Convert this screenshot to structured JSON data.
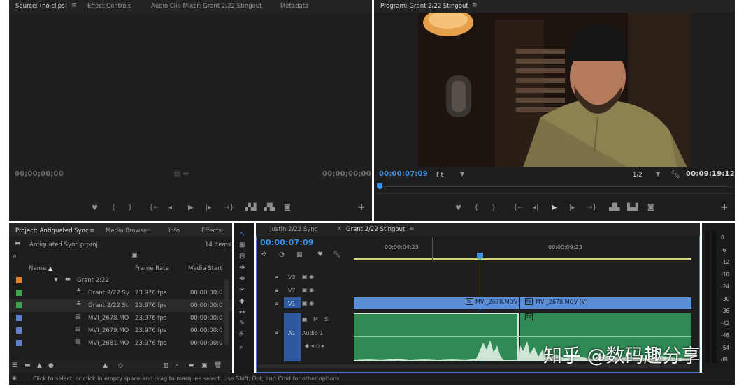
{
  "source_monitor": {
    "tabs": [
      "Source: (no clips)",
      "Effect Controls",
      "Audio Clip Mixer: Grant 2/22 Stingout",
      "Metadata"
    ],
    "menu_icon": "≡",
    "timecode_left": "00;00;00;00",
    "timecode_right": "00;00;00;00",
    "controls": [
      "marker-icon",
      "mark-in-icon",
      "mark-out-icon",
      "go-to-in-icon",
      "step-back-icon",
      "play-icon",
      "step-forward-icon",
      "go-to-out-icon",
      "insert-icon",
      "overwrite-icon",
      "export-frame-icon"
    ]
  },
  "program_monitor": {
    "title": "Program: Grant 2/22 Stingout",
    "menu_icon": "≡",
    "timecode": "00:00:07:09",
    "fit_label": "Fit",
    "resolution": "1/2",
    "duration": "00:09:19:12"
  },
  "project": {
    "tabs": [
      "Project: Antiquated Sync",
      "Media Browser",
      "Info",
      "Effects"
    ],
    "menu_icon": "≡",
    "file_name": "Antiquated Sync.prproj",
    "item_count": "14 Items",
    "columns": {
      "name": "Name",
      "sort_arrow": "▲",
      "frame_rate": "Frame Rate",
      "media_start": "Media Start"
    },
    "folder": {
      "name": "Grant 2:22",
      "color": "#e8822a"
    },
    "items": [
      {
        "name": "Grant 2/22 Sy",
        "fps": "23.976 fps",
        "start": "00:00:00:0",
        "color": "#3aa64a",
        "kind": "sequence-icon"
      },
      {
        "name": "Grant 2/22 Sti",
        "fps": "23.976 fps",
        "start": "00:00:00:0",
        "color": "#3aa64a",
        "kind": "sequence-icon"
      },
      {
        "name": "MVI_2678.MO",
        "fps": "23.976 fps",
        "start": "00:00:00:0",
        "color": "#5b7fd4",
        "kind": "clip-icon"
      },
      {
        "name": "MVI_2679.MO",
        "fps": "23.976 fps",
        "start": "00:00:00:0",
        "color": "#5b7fd4",
        "kind": "clip-icon"
      },
      {
        "name": "MVI_2681.MO",
        "fps": "23.976 fps",
        "start": "00:00:00:0",
        "color": "#5b7fd4",
        "kind": "clip-icon"
      }
    ]
  },
  "timeline": {
    "tabs": [
      "Justin 2/22 Sync",
      "Grant 2/22 Stingout"
    ],
    "close_icon": "×",
    "menu_icon": "≡",
    "timecode": "00:00:07:09",
    "ruler": [
      "00:00:04:23",
      "00:00:09:23"
    ],
    "tracks": {
      "v3": "V3",
      "v2": "V2",
      "v1": "V1",
      "a1": "A1",
      "audio_name": "Audio 1",
      "mute": "M",
      "solo": "S"
    },
    "clips": {
      "clip1": "MVI_2678.MOV",
      "clip2": "MVI_2678.MOV [V]",
      "fx": "fx"
    }
  },
  "meters": [
    "0",
    "-6",
    "-12",
    "-18",
    "-24",
    "-30",
    "-36",
    "-42",
    "-48",
    "-54",
    "dB"
  ],
  "status_bar": "Click to select, or click in empty space and drag to marquee select. Use Shift, Opt, and Cmd for other options.",
  "watermark": "知乎 @数码趣分享",
  "colors": {
    "accent": "#2d8ceb",
    "clip_video": "#5a8ed8",
    "clip_audio": "#2f8a55",
    "ruler_line": "#d4d27a"
  }
}
